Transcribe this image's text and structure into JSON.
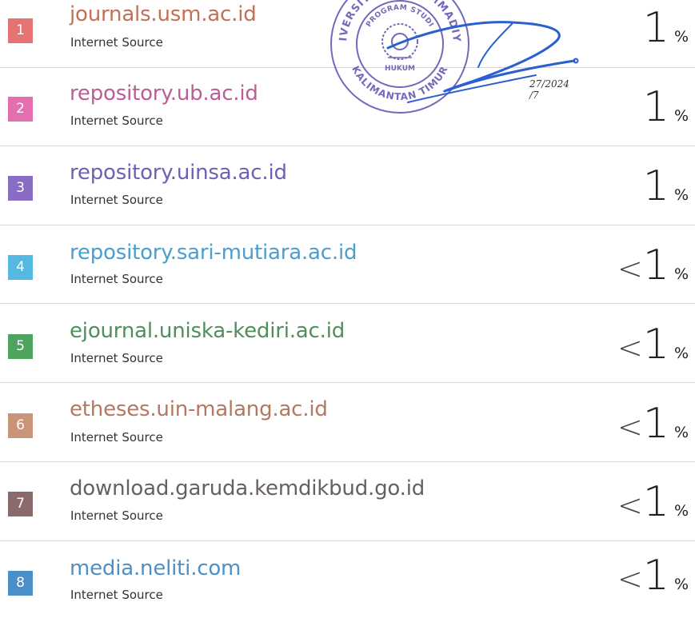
{
  "sources": [
    {
      "index": "1",
      "name": "journals.usm.ac.id",
      "type": "Internet Source",
      "lt": "",
      "value": "1",
      "percent_sign": "%",
      "badge_color": "#e57373",
      "name_color": "#c46f56"
    },
    {
      "index": "2",
      "name": "repository.ub.ac.id",
      "type": "Internet Source",
      "lt": "",
      "value": "1",
      "percent_sign": "%",
      "badge_color": "#e46fae",
      "name_color": "#bb5e97"
    },
    {
      "index": "3",
      "name": "repository.uinsa.ac.id",
      "type": "Internet Source",
      "lt": "",
      "value": "1",
      "percent_sign": "%",
      "badge_color": "#8a6cc4",
      "name_color": "#6b62b4"
    },
    {
      "index": "4",
      "name": "repository.sari-mutiara.ac.id",
      "type": "Internet Source",
      "lt": "<",
      "value": "1",
      "percent_sign": "%",
      "badge_color": "#55b8e0",
      "name_color": "#4a9ed0"
    },
    {
      "index": "5",
      "name": "ejournal.uniska-kediri.ac.id",
      "type": "Internet Source",
      "lt": "<",
      "value": "1",
      "percent_sign": "%",
      "badge_color": "#4ea35e",
      "name_color": "#508f5c"
    },
    {
      "index": "6",
      "name": "etheses.uin-malang.ac.id",
      "type": "Internet Source",
      "lt": "<",
      "value": "1",
      "percent_sign": "%",
      "badge_color": "#c99477",
      "name_color": "#b27860"
    },
    {
      "index": "7",
      "name": "download.garuda.kemdikbud.go.id",
      "type": "Internet Source",
      "lt": "<",
      "value": "1",
      "percent_sign": "%",
      "badge_color": "#8a6a6a",
      "name_color": "#676060"
    },
    {
      "index": "8",
      "name": "media.neliti.com",
      "type": "Internet Source",
      "lt": "<",
      "value": "1",
      "percent_sign": "%",
      "badge_color": "#4a8fc8",
      "name_color": "#4f8fc4"
    }
  ],
  "stamp": {
    "top_text": "UNIVERSITAS MUHAMMADIYAH",
    "program_text": "PROGRAM STUDI",
    "center_text": "HUKUM",
    "bottom_text": "KALIMANTAN TIMUR",
    "ink_color": "#5a4fb0"
  },
  "handwritten_date": {
    "line1": "27/2024",
    "line2": "/7"
  },
  "signature_color": "#2a5fd0"
}
